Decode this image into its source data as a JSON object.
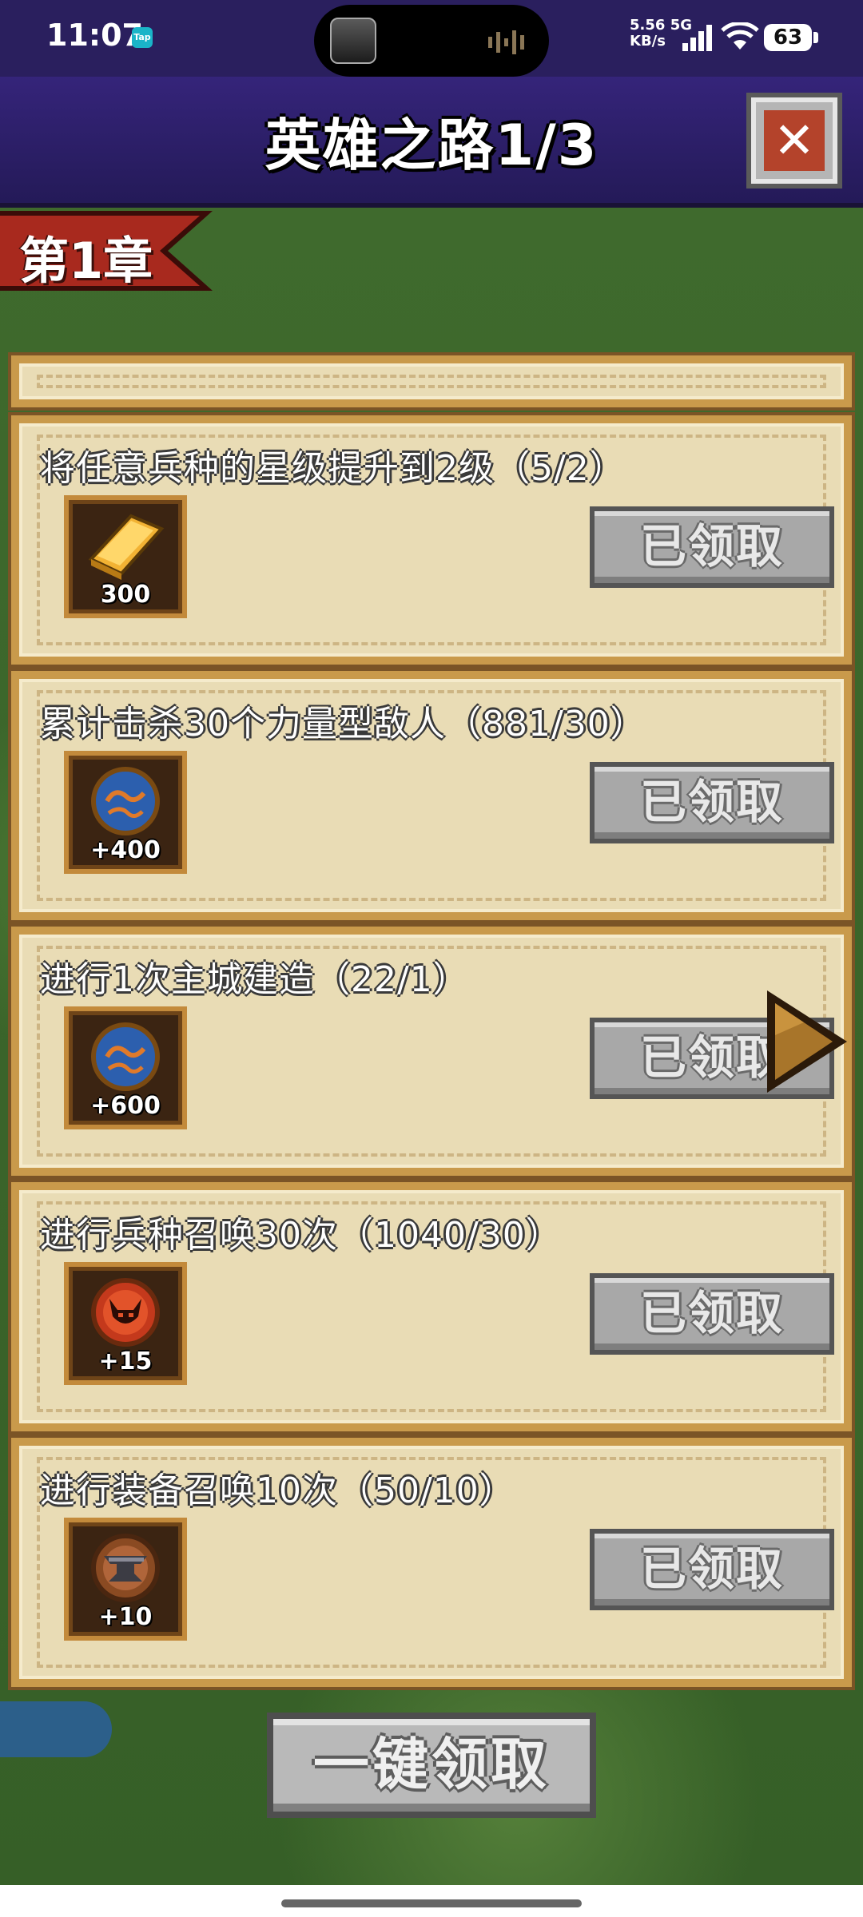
{
  "status_bar": {
    "time": "11:07",
    "app_badge": "Tap",
    "net_speed": "5.56",
    "net_unit": "KB/s",
    "net_type": "5G",
    "battery": "63"
  },
  "header": {
    "title": "英雄之路1/3",
    "close_label": "✕"
  },
  "chapter": {
    "label": "第1章"
  },
  "tasks": [
    {
      "title": "将任意兵种的星级提升到2级（5/2）",
      "reward_icon": "gold-bar-icon",
      "reward_amount": "300",
      "button_label": "已领取"
    },
    {
      "title": "累计击杀30个力量型敌人（881/30）",
      "reward_icon": "blue-orb-icon",
      "reward_amount": "+400",
      "button_label": "已领取"
    },
    {
      "title": "进行1次主城建造（22/1）",
      "reward_icon": "blue-orb-icon",
      "reward_amount": "+600",
      "button_label": "已领取"
    },
    {
      "title": "进行兵种召唤30次（1040/30）",
      "reward_icon": "demon-token-icon",
      "reward_amount": "+15",
      "button_label": "已领取"
    },
    {
      "title": "进行装备召唤10次（50/10）",
      "reward_icon": "anvil-token-icon",
      "reward_amount": "+10",
      "button_label": "已领取"
    }
  ],
  "footer": {
    "claim_all_label": "一键领取"
  },
  "colors": {
    "header_bg": "#2a1f5e",
    "card_bg": "#e9dcb5",
    "card_border": "#c99a4b",
    "button_gray": "#a8a8a8",
    "banner_red": "#a8291e"
  }
}
